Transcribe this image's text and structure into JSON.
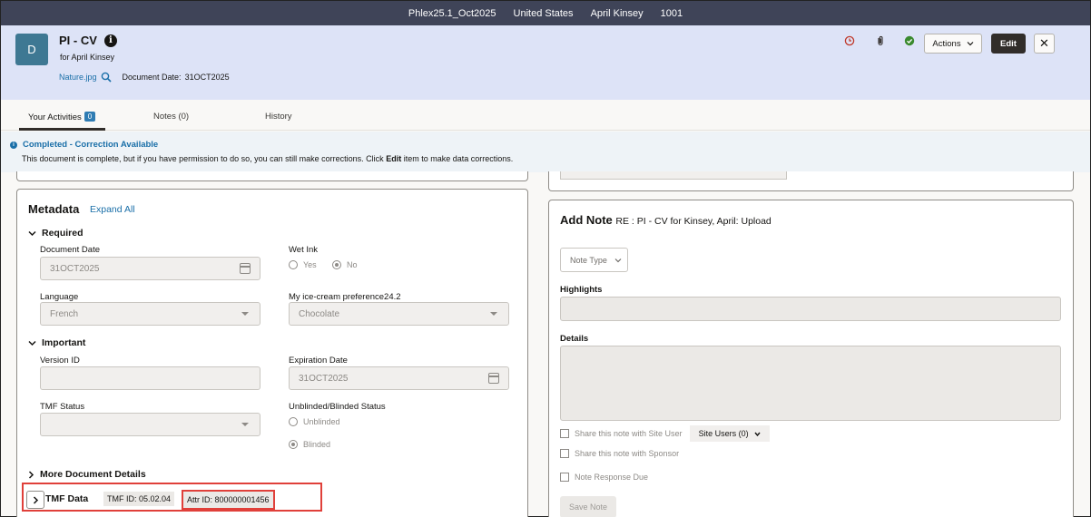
{
  "topbar": {
    "items": [
      "Phlex25.1_Oct2025",
      "United States",
      "April Kinsey",
      "1001"
    ]
  },
  "header": {
    "avatar_letter": "D",
    "title": "PI - CV",
    "subtitle": "for April Kinsey",
    "file_link": "Nature.jpg",
    "document_date_label": "Document Date:",
    "document_date_value": "31OCT2025",
    "actions_label": "Actions",
    "edit_label": "Edit",
    "close_label": "✕",
    "icons": [
      "history-icon",
      "attachment-icon",
      "status-complete-icon"
    ],
    "colors": {
      "history": "#c0392b",
      "complete": "#3a8a2e"
    }
  },
  "tabs": [
    {
      "label": "Your Activities",
      "badge": "0"
    },
    {
      "label": "Notes (0)"
    },
    {
      "label": "History"
    }
  ],
  "banner": {
    "title": "Completed - Correction Available",
    "text_before": "This document is complete, but if you have permission to do so, you can still make corrections. Click ",
    "text_bold": "Edit",
    "text_after": " item to make data corrections."
  },
  "metadata": {
    "title": "Metadata",
    "expand_all": "Expand All",
    "required": {
      "heading": "Required",
      "document_date_label": "Document Date",
      "document_date_value": "31OCT2025",
      "wet_ink_label": "Wet Ink",
      "wet_ink_yes": "Yes",
      "wet_ink_no": "No",
      "language_label": "Language",
      "language_value": "French",
      "icecream_label": "My ice-cream preference24.2",
      "icecream_value": "Chocolate"
    },
    "important": {
      "heading": "Important",
      "version_label": "Version ID",
      "version_value": "",
      "expiration_label": "Expiration Date",
      "expiration_value": "31OCT2025",
      "tmf_status_label": "TMF Status",
      "tmf_status_value": "",
      "blinded_label": "Unblinded/Blinded Status",
      "unblinded": "Unblinded",
      "blinded": "Blinded"
    },
    "more_details": "More Document Details",
    "tmf": {
      "label": "TMF Data",
      "tmf_id": "TMF ID: 05.02.04",
      "attr_id": "Attr ID: 800000001456"
    }
  },
  "note": {
    "title": "Add Note",
    "subtitle": "RE : PI - CV for Kinsey, April: Upload",
    "note_type": "Note Type",
    "highlights_label": "Highlights",
    "details_label": "Details",
    "share_site_user": "Share this note with Site User",
    "site_users": "Site Users (0)",
    "share_sponsor": "Share this note with Sponsor",
    "response_due": "Note Response Due",
    "save_label": "Save Note"
  }
}
